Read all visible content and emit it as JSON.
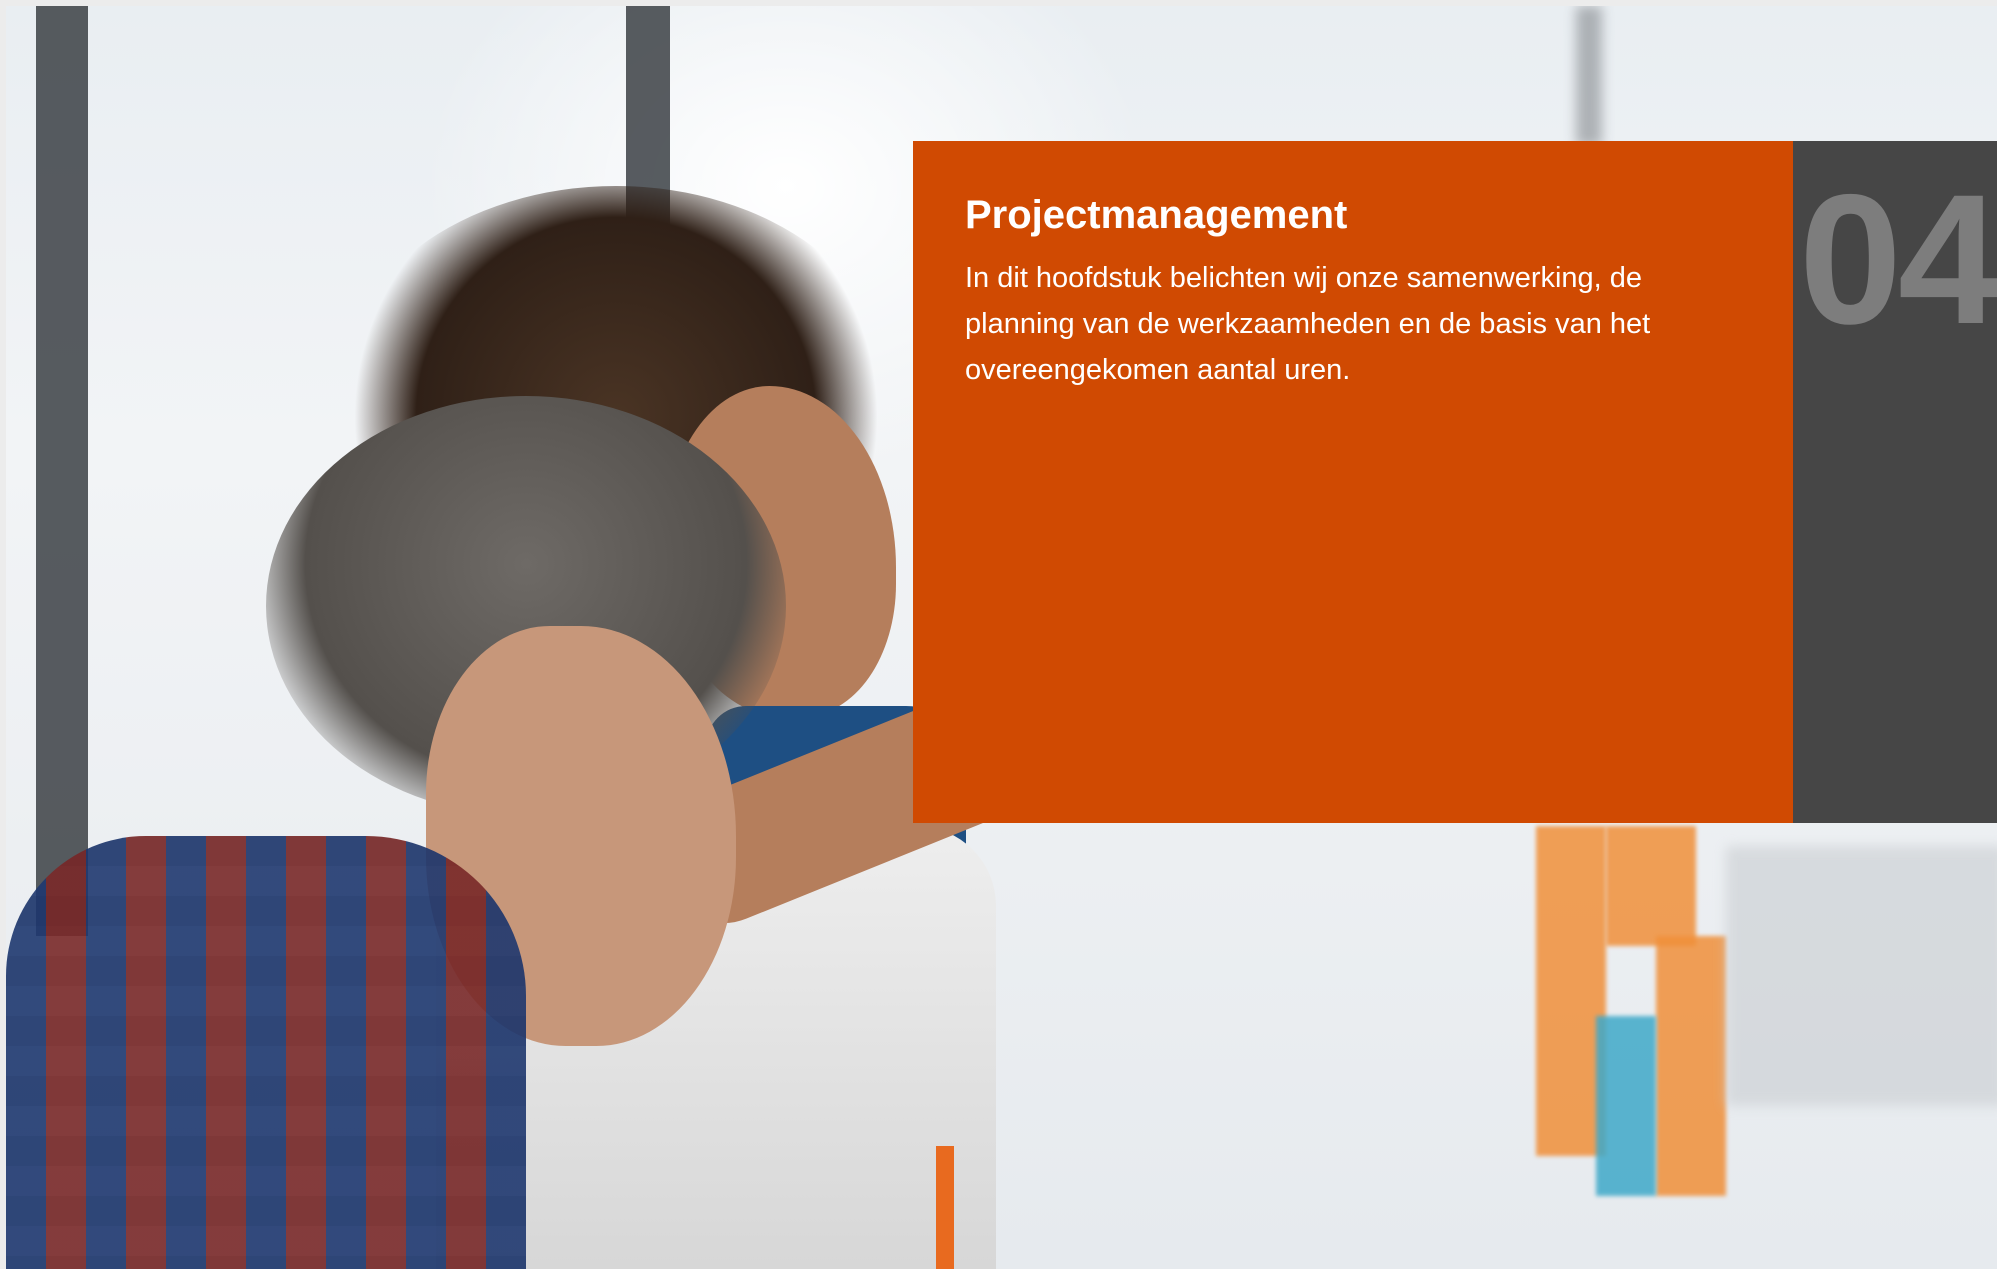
{
  "chapter": {
    "title": "Projectmanagement",
    "description": "In dit hoofdstuk belichten wij onze samenwerking, de planning van de werkzaamheden en de basis van het overeengekomen aantal uren.",
    "number": "04"
  },
  "colors": {
    "accent": "#d04a02",
    "number_panel": "#464646",
    "number_text": "#7d7d7d",
    "text": "#ffffff"
  }
}
